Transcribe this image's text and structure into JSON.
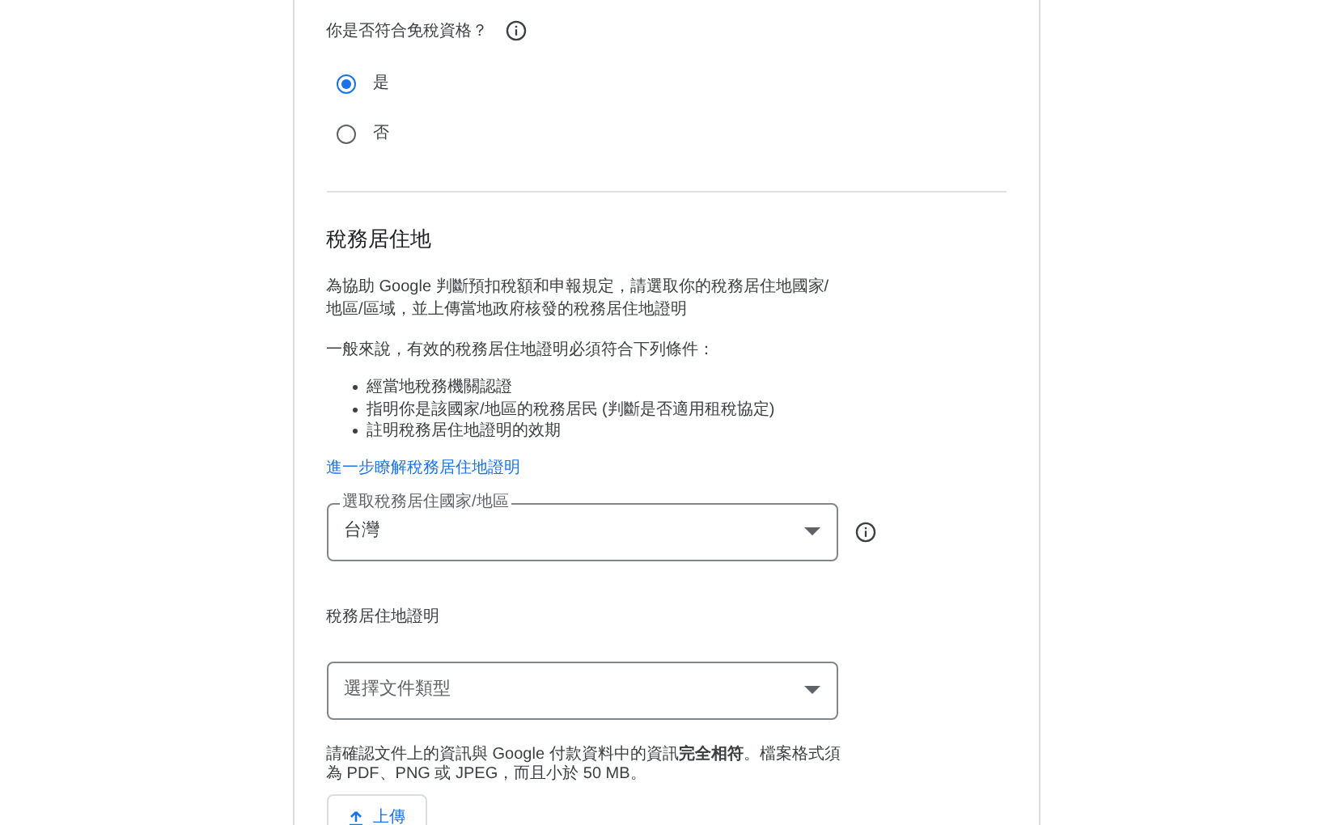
{
  "exemption": {
    "question": "你是否符合免稅資格？",
    "options": [
      {
        "label": "是",
        "selected": true
      },
      {
        "label": "否",
        "selected": false
      }
    ]
  },
  "residency": {
    "heading": "稅務居住地",
    "intro": "為協助 Google 判斷預扣稅額和申報規定，請選取你的稅務居住地國家/地區/區域，並上傳當地政府核發的稅務居住地證明",
    "criteria_intro": "一般來說，有效的稅務居住地證明必須符合下列條件：",
    "criteria": [
      "經當地稅務機關認證",
      "指明你是該國家/地區的稅務居民 (判斷是否適用租稅協定)",
      "註明稅務居住地證明的效期"
    ],
    "learn_more_link": "進一步瞭解稅務居住地證明",
    "country_select": {
      "label": "選取稅務居住國家/地區",
      "value": "台灣"
    },
    "certificate_label": "稅務居住地證明",
    "document_select": {
      "placeholder": "選擇文件類型"
    },
    "note": "請確認文件上的資訊與 Google 付款資料中的資訊**完全相符**。檔案格式須為 PDF、PNG 或 JPEG，而且小於 50 MB。",
    "upload_button": "上傳"
  }
}
